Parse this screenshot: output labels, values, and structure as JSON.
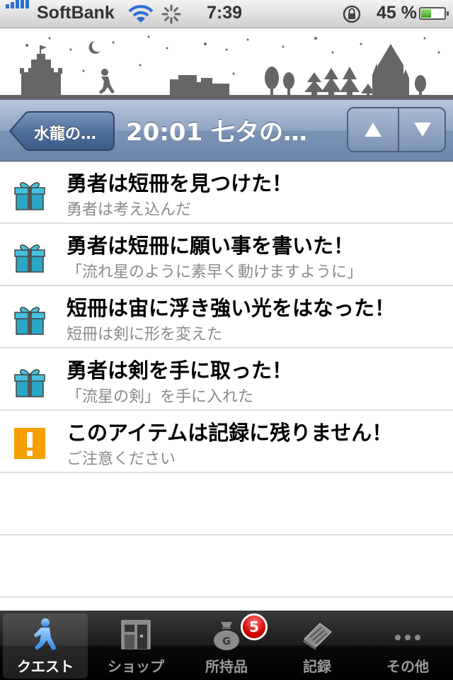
{
  "status_bar": {
    "carrier": "SoftBank",
    "time": "7:39",
    "battery": "45 %",
    "battery_level": 0.45
  },
  "nav": {
    "back_label": "水龍の…",
    "title": "20:01 七タの…"
  },
  "list": {
    "items": [
      {
        "icon": "gift-icon",
        "title": "勇者は短冊を見つけた！",
        "subtitle": "勇者は考え込んだ"
      },
      {
        "icon": "gift-icon",
        "title": "勇者は短冊に願い事を書いた！",
        "subtitle": "「流れ星のように素早く動けますように」"
      },
      {
        "icon": "gift-icon",
        "title": "短冊は宙に浮き強い光をはなった！",
        "subtitle": "短冊は剣に形を変えた"
      },
      {
        "icon": "gift-icon",
        "title": "勇者は剣を手に取った！",
        "subtitle": "「流星の剣」を手に入れた"
      },
      {
        "icon": "warning-icon",
        "title": "このアイテムは記録に残りません！",
        "subtitle": "ご注意ください"
      }
    ]
  },
  "tabbar": {
    "tabs": [
      {
        "label": "クエスト",
        "icon": "hero-icon",
        "selected": true
      },
      {
        "label": "ショップ",
        "icon": "shop-icon",
        "selected": false
      },
      {
        "label": "所持品",
        "icon": "bag-icon",
        "selected": false,
        "badge": "5"
      },
      {
        "label": "記録",
        "icon": "book-icon",
        "selected": false
      },
      {
        "label": "その他",
        "icon": "more-icon",
        "selected": false
      }
    ]
  },
  "colors": {
    "nav_blue": "#7a93b5",
    "gift_teal": "#2aa7c4",
    "warning_orange": "#f5a000",
    "badge_red": "#d40000"
  }
}
